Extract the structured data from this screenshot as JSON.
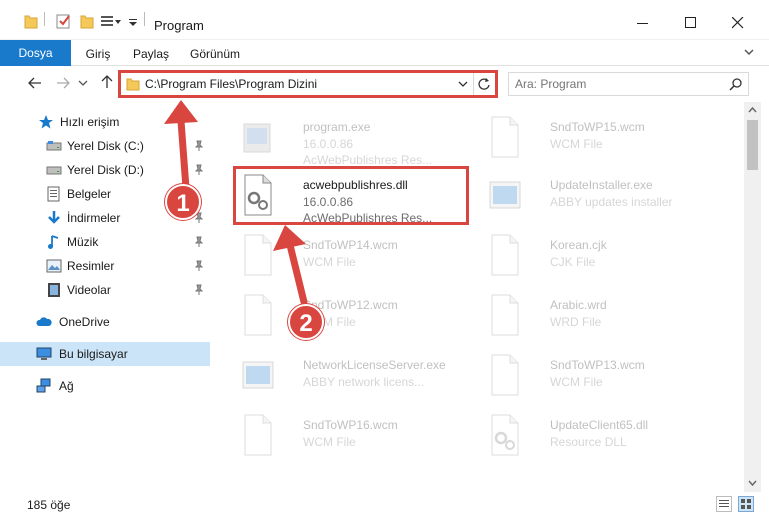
{
  "window": {
    "title": "Program",
    "minimize_icon": "minimize-icon",
    "maximize_icon": "maximize-icon",
    "close_icon": "close-icon"
  },
  "ribbon": {
    "tabs": [
      "Dosya",
      "Giriş",
      "Paylaş",
      "Görünüm"
    ]
  },
  "address": {
    "path": "C:\\Program Files\\Program Dizini",
    "search_placeholder": "Ara: Program"
  },
  "sidebar": {
    "items": [
      {
        "label": "Hızlı erişim",
        "icon": "star-icon"
      },
      {
        "label": "Yerel Disk (C:)",
        "icon": "drive-icon"
      },
      {
        "label": "Yerel Disk (D:)",
        "icon": "drive-icon"
      },
      {
        "label": "Belgeler",
        "icon": "documents-icon"
      },
      {
        "label": "İndirmeler",
        "icon": "download-icon"
      },
      {
        "label": "Müzik",
        "icon": "music-icon"
      },
      {
        "label": "Resimler",
        "icon": "pictures-icon"
      },
      {
        "label": "Videolar",
        "icon": "videos-icon"
      },
      {
        "label": "OneDrive",
        "icon": "cloud-icon"
      },
      {
        "label": "Bu bilgisayar",
        "icon": "computer-icon"
      },
      {
        "label": "Ağ",
        "icon": "network-icon"
      }
    ]
  },
  "files": {
    "left": [
      {
        "name": "program.exe",
        "meta1": "16.0.0.86",
        "meta2": "AcWebPublishres Res..."
      },
      {
        "name": "acwebpublishres.dll",
        "meta1": "16.0.0.86",
        "meta2": "AcWebPublishres Res..."
      },
      {
        "name": "SndToWP14.wcm",
        "meta1": "WCM File",
        "meta2": ""
      },
      {
        "name": "SndToWP12.wcm",
        "meta1": "WCM File",
        "meta2": ""
      },
      {
        "name": "NetworkLicenseServer.exe",
        "meta1": "ABBY network licens...",
        "meta2": ""
      },
      {
        "name": "SndToWP16.wcm",
        "meta1": "WCM File",
        "meta2": ""
      }
    ],
    "right": [
      {
        "name": "SndToWP15.wcm",
        "meta1": "WCM File",
        "meta2": ""
      },
      {
        "name": "UpdateInstaller.exe",
        "meta1": "ABBY updates installer",
        "meta2": ""
      },
      {
        "name": "Korean.cjk",
        "meta1": "CJK File",
        "meta2": ""
      },
      {
        "name": "Arabic.wrd",
        "meta1": "WRD File",
        "meta2": ""
      },
      {
        "name": "SndToWP13.wcm",
        "meta1": "WCM File",
        "meta2": ""
      },
      {
        "name": "UpdateClient65.dll",
        "meta1": "Resource DLL",
        "meta2": ""
      }
    ]
  },
  "status": {
    "item_count": "185 öğe"
  },
  "annotations": {
    "badge1": "1",
    "badge2": "2",
    "color": "#d9453f"
  },
  "colors": {
    "accent": "#1979ca",
    "selection": "#cce4f7"
  }
}
